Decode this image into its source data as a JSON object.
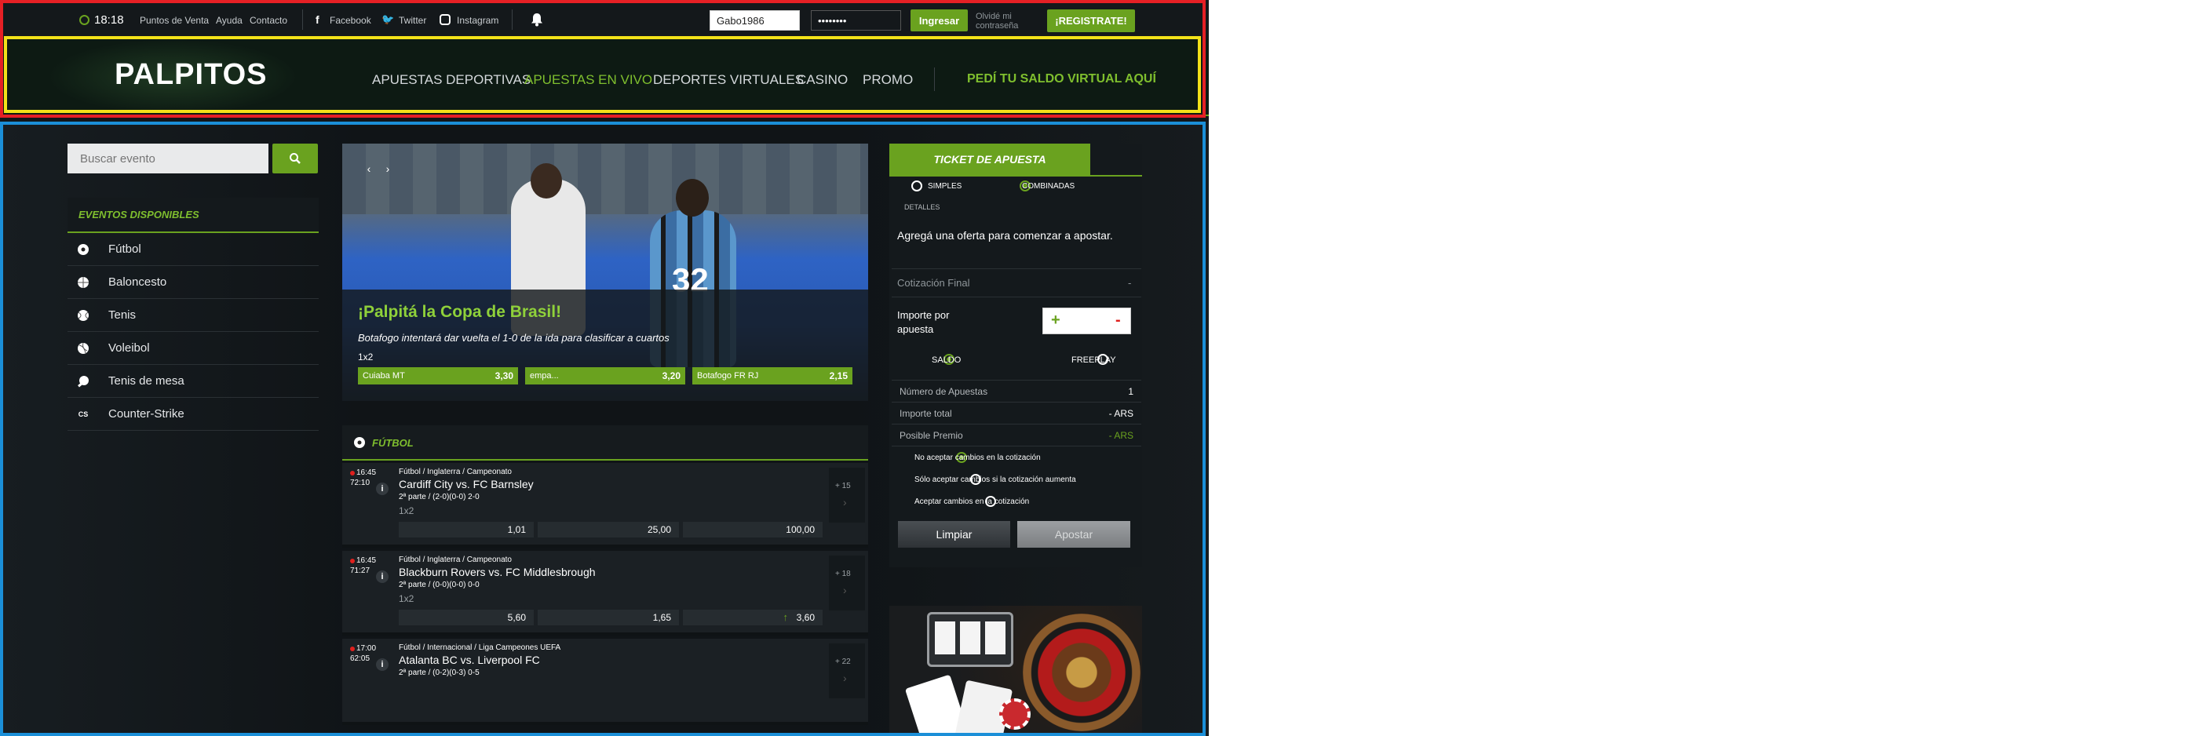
{
  "topbar": {
    "time": "18:18",
    "links": [
      "Puntos de Venta",
      "Ayuda",
      "Contacto"
    ],
    "social": {
      "facebook": "Facebook",
      "twitter": "Twitter",
      "instagram": "Instagram"
    },
    "username_value": "Gabo1986",
    "password_value": "••••••••",
    "login_label": "Ingresar",
    "forgot_line1": "Olvidé mi",
    "forgot_line2": "contraseña",
    "register_label": "¡REGISTRATE!"
  },
  "header": {
    "logo": "PALPITOS",
    "nav": [
      "APUESTAS DEPORTIVAS",
      "APUESTAS EN VIVO",
      "DEPORTES VIRTUALES",
      "CASINO",
      "PROMO"
    ],
    "cta": "PEDÍ TU SALDO VIRTUAL AQUÍ"
  },
  "sidebar": {
    "search_placeholder": "Buscar evento",
    "events_title": "EVENTOS DISPONIBLES",
    "items": [
      {
        "label": "Fútbol",
        "icon": "soccer-ball-icon"
      },
      {
        "label": "Baloncesto",
        "icon": "basketball-icon"
      },
      {
        "label": "Tenis",
        "icon": "tennis-ball-icon"
      },
      {
        "label": "Voleibol",
        "icon": "volleyball-icon"
      },
      {
        "label": "Tenis de mesa",
        "icon": "table-tennis-icon"
      },
      {
        "label": "Counter-Strike",
        "icon": "counter-strike-icon"
      }
    ]
  },
  "banner": {
    "title": "¡Palpitá la Copa de Brasil!",
    "subtitle": "Botafogo intentará dar vuelta el 1-0 de la ida para clasificar a cuartos",
    "market": "1x2",
    "odds": [
      {
        "team": "Cuiaba MT",
        "value": "3,30"
      },
      {
        "team": "empa...",
        "value": "3,20"
      },
      {
        "team": "Botafogo FR RJ",
        "value": "2,15"
      }
    ],
    "jersey_number": "32"
  },
  "section": {
    "title": "FÚTBOL"
  },
  "matches": [
    {
      "time": "16:45",
      "elapsed": "72:10",
      "league": "Fútbol / Inglaterra / Campeonato",
      "teams": "Cardiff City vs. FC Barnsley",
      "period": "2ª parte / (2-0)(0-0) 2-0",
      "market": "1x2",
      "odds": [
        "1,01",
        "25,00",
        "100,00"
      ],
      "more": "+ 15"
    },
    {
      "time": "16:45",
      "elapsed": "71:27",
      "league": "Fútbol / Inglaterra / Campeonato",
      "teams": "Blackburn Rovers vs. FC Middlesbrough",
      "period": "2ª parte / (0-0)(0-0) 0-0",
      "market": "1x2",
      "odds": [
        "5,60",
        "1,65",
        "3,60"
      ],
      "more": "+ 18"
    },
    {
      "time": "17:00",
      "elapsed": "62:05",
      "league": "Fútbol / Internacional / Liga Campeones UEFA",
      "teams": "Atalanta BC vs. Liverpool FC",
      "period": "2ª parte / (0-2)(0-3) 0-5",
      "market": "",
      "odds": [],
      "more": "+ 22"
    }
  ],
  "ticket": {
    "title": "TICKET DE APUESTA",
    "simple": "SIMPLES",
    "combined": "COMBINADAS",
    "details": "DETALLES",
    "empty_msg": "Agregá una oferta para comenzar a apostar.",
    "final_quote": "Cotización Final",
    "final_quote_value": "-",
    "import_label_1": "Importe por",
    "import_label_2": "apuesta",
    "plus": "+",
    "minus": "-",
    "saldo": "SALDO",
    "freeplay": "FREEPLAY",
    "rows": [
      {
        "label": "Número de Apuestas",
        "value": "1"
      },
      {
        "label": "Importe total",
        "value": "- ARS"
      },
      {
        "label": "Posible Premio",
        "value": "- ARS"
      }
    ],
    "options": [
      "No aceptar cambios en la cotización",
      "Sólo aceptar cambios si la cotización aumenta",
      "Aceptar cambios en la cotización"
    ],
    "clear_label": "Limpiar",
    "bet_label": "Apostar"
  },
  "colors": {
    "accent": "#6aa21f",
    "live_dot": "#e0201d"
  }
}
